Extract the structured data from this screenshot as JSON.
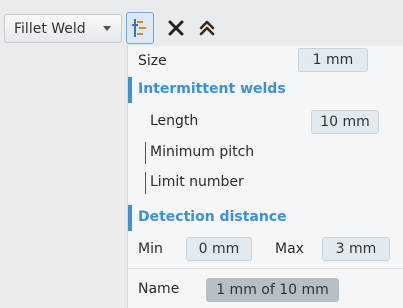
{
  "toolbar": {
    "mode_select": "Fillet Weld",
    "icons": [
      "weld-settings-icon",
      "close-icon",
      "collapse-up-icon"
    ],
    "accent_color": "#3d8fd8"
  },
  "panel": {
    "size": {
      "label": "Size",
      "value": "1 mm"
    },
    "intermittent": {
      "title": "Intermittent welds",
      "length_label": "Length",
      "length_value": "10 mm",
      "min_pitch_label": "Minimum pitch",
      "limit_number_label": "Limit number"
    },
    "detection": {
      "title": "Detection distance",
      "min_label": "Min",
      "min_value": "0 mm",
      "max_label": "Max",
      "max_value": "3 mm"
    },
    "name": {
      "label": "Name",
      "value": "1 mm of 10 mm"
    }
  }
}
